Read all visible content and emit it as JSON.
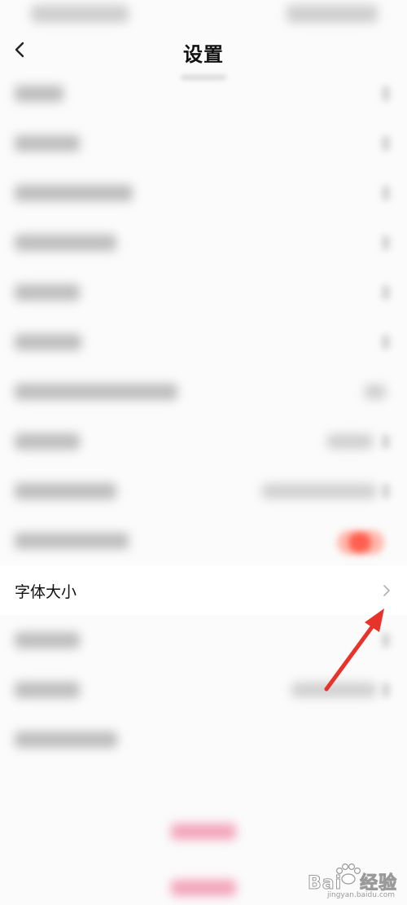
{
  "header": {
    "title": "设置"
  },
  "settings": {
    "font_size_label": "字体大小"
  },
  "watermark": {
    "brand": "Bai",
    "brand_suffix": "经验",
    "url": "jingyan.baidu.com"
  },
  "colors": {
    "annotation_arrow": "#e8332a",
    "toggle_on": "#ff5f4e"
  },
  "icons": {
    "back": "chevron-left-icon",
    "row_chevron": "chevron-right-icon"
  }
}
